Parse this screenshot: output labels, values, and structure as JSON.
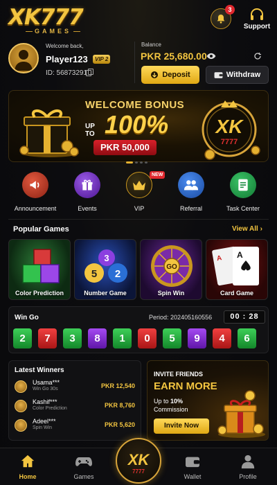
{
  "header": {
    "logo_text": "XK777",
    "logo_sub": "GAMES",
    "notification_count": "3",
    "support_label": "Support"
  },
  "account": {
    "welcome": "Welcome back,",
    "username": "Player123",
    "vip_level": "VIP 2",
    "user_id": "ID: 56873291",
    "balance_label": "Balance",
    "balance_value": "PKR 25,680.00",
    "deposit_label": "Deposit",
    "withdraw_label": "Withdraw"
  },
  "banner": {
    "title": "WELCOME BONUS",
    "up_to": "UP TO",
    "percent": "100%",
    "amount": "PKR 50,000",
    "logo_text": "XK",
    "logo_sub": "7777",
    "slide_count": 4,
    "active_slide": 0
  },
  "quick_menu": {
    "items": [
      {
        "label": "Announcement",
        "icon": "megaphone-icon",
        "color": "#c7402a"
      },
      {
        "label": "Events",
        "icon": "gift-icon",
        "color": "#7a37c8"
      },
      {
        "label": "VIP",
        "icon": "crown-icon",
        "color": "#b8860b",
        "badge": "NEW"
      },
      {
        "label": "Referral",
        "icon": "people-icon",
        "color": "#2a6fd6"
      },
      {
        "label": "Task Center",
        "icon": "task-icon",
        "color": "#25a04a"
      }
    ]
  },
  "popular_games": {
    "title": "Popular Games",
    "view_all": "View All",
    "games": [
      {
        "label": "Color Prediction"
      },
      {
        "label": "Number Game"
      },
      {
        "label": "Spin Win"
      },
      {
        "label": "Card Game"
      }
    ]
  },
  "wingo": {
    "title": "Win Go",
    "period_label": "Period:",
    "period_value": "202405160556",
    "timer": "00 : 28",
    "results": [
      {
        "n": "2",
        "color": "green"
      },
      {
        "n": "7",
        "color": "red"
      },
      {
        "n": "3",
        "color": "green"
      },
      {
        "n": "8",
        "color": "violet"
      },
      {
        "n": "1",
        "color": "green"
      },
      {
        "n": "0",
        "color": "red"
      },
      {
        "n": "5",
        "color": "green"
      },
      {
        "n": "9",
        "color": "violet"
      },
      {
        "n": "4",
        "color": "red"
      },
      {
        "n": "6",
        "color": "green"
      }
    ]
  },
  "winners": {
    "title": "Latest Winners",
    "rows": [
      {
        "name": "Usama***",
        "game": "Win Go 30s",
        "amount": "PKR 12,540"
      },
      {
        "name": "Kashif***",
        "game": "Color Prediction",
        "amount": "PKR 8,760"
      },
      {
        "name": "Adeel***",
        "game": "Spin Win",
        "amount": "PKR 5,620"
      }
    ]
  },
  "invite": {
    "title": "INVITE FRIENDS",
    "headline": "EARN MORE",
    "up_to": "Up to",
    "percent": "10%",
    "commission": "Commission",
    "button": "Invite Now"
  },
  "bottom_nav": {
    "items": [
      {
        "label": "Home",
        "icon": "home-icon",
        "active": true
      },
      {
        "label": "Games",
        "icon": "gamepad-icon",
        "active": false
      },
      {
        "label": "Wallet",
        "icon": "wallet-icon",
        "active": false
      },
      {
        "label": "Profile",
        "icon": "profile-icon",
        "active": false
      }
    ],
    "center_logo": "XK",
    "center_logo_sub": "7777"
  },
  "colors": {
    "accent_gold": "#f3c540",
    "background": "#0b0b0e",
    "green": "#3ecf58",
    "red": "#f04040",
    "violet": "#a54af2"
  }
}
